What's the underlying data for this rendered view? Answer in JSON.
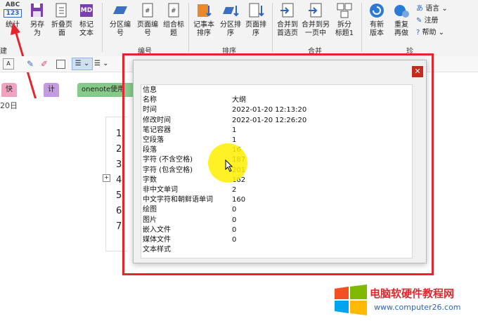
{
  "ribbon": {
    "buttons": [
      {
        "label": "统计",
        "icon": "abc-123-stats-icon"
      },
      {
        "label": "另存\n为",
        "icon": "save-as-icon"
      },
      {
        "label": "折叠页\n面",
        "icon": "fold-page-icon"
      },
      {
        "label": "标记\n文本",
        "icon": "md-markdown-icon"
      },
      {
        "label": "分区编\n号",
        "icon": "section-number-icon"
      },
      {
        "label": "页面编\n号",
        "icon": "page-number-icon"
      },
      {
        "label": "组合标\n题",
        "icon": "combine-title-icon"
      },
      {
        "label": "记事本\n排序",
        "icon": "notebook-sort-icon"
      },
      {
        "label": "分区排\n序",
        "icon": "section-sort-icon"
      },
      {
        "label": "页面排\n序",
        "icon": "page-sort-icon"
      },
      {
        "label": "合并到\n首选页",
        "icon": "merge-first-icon"
      },
      {
        "label": "合并到另\n一页中",
        "icon": "merge-other-icon"
      },
      {
        "label": "拆分\n标题1",
        "icon": "split-title-icon"
      },
      {
        "label": "有新\n版本",
        "icon": "new-version-icon"
      },
      {
        "label": "重复\n再做",
        "icon": "redo-icon"
      }
    ],
    "small_buttons": [
      "语言",
      "注册",
      "帮助"
    ],
    "groups": [
      "建",
      "编号",
      "排序",
      "合并",
      "珍"
    ]
  },
  "tabs": [
    "快速笔记",
    "计算机",
    "onenote使用"
  ],
  "page": {
    "date": "20日",
    "list_numbers": [
      "1",
      "2",
      "3",
      "4",
      "5",
      "6",
      "7"
    ]
  },
  "dialog": {
    "rows": [
      {
        "k": "信息",
        "v": ""
      },
      {
        "k": "名称",
        "v": "大纲"
      },
      {
        "k": "时间",
        "v": "2022-01-20 12:13:20"
      },
      {
        "k": "修改时间",
        "v": "2022-01-20 12:26:20"
      },
      {
        "k": "笔记容器",
        "v": "1"
      },
      {
        "k": "空段落",
        "v": "1"
      },
      {
        "k": "段落",
        "v": "16"
      },
      {
        "k": "字符 (不含空格)",
        "v": "187"
      },
      {
        "k": "字符 (包含空格)",
        "v": "201"
      },
      {
        "k": "字数",
        "v": "162"
      },
      {
        "k": "非中文单词",
        "v": "2"
      },
      {
        "k": "中文字符和朝鲜语单词",
        "v": "160"
      },
      {
        "k": "绘图",
        "v": "0"
      },
      {
        "k": "图片",
        "v": "0"
      },
      {
        "k": "嵌入文件",
        "v": "0"
      },
      {
        "k": "媒体文件",
        "v": "0"
      },
      {
        "k": "文本样式",
        "v": ""
      }
    ]
  },
  "watermark": {
    "title": "电脑软硬件教程网",
    "url": "www.computer26.com"
  },
  "colors": {
    "accent": "#2b66c4",
    "red": "#e3262b",
    "tab_pink": "#f0a3c0",
    "tab_purple": "#c49be0",
    "tab_green": "#86c98a"
  }
}
